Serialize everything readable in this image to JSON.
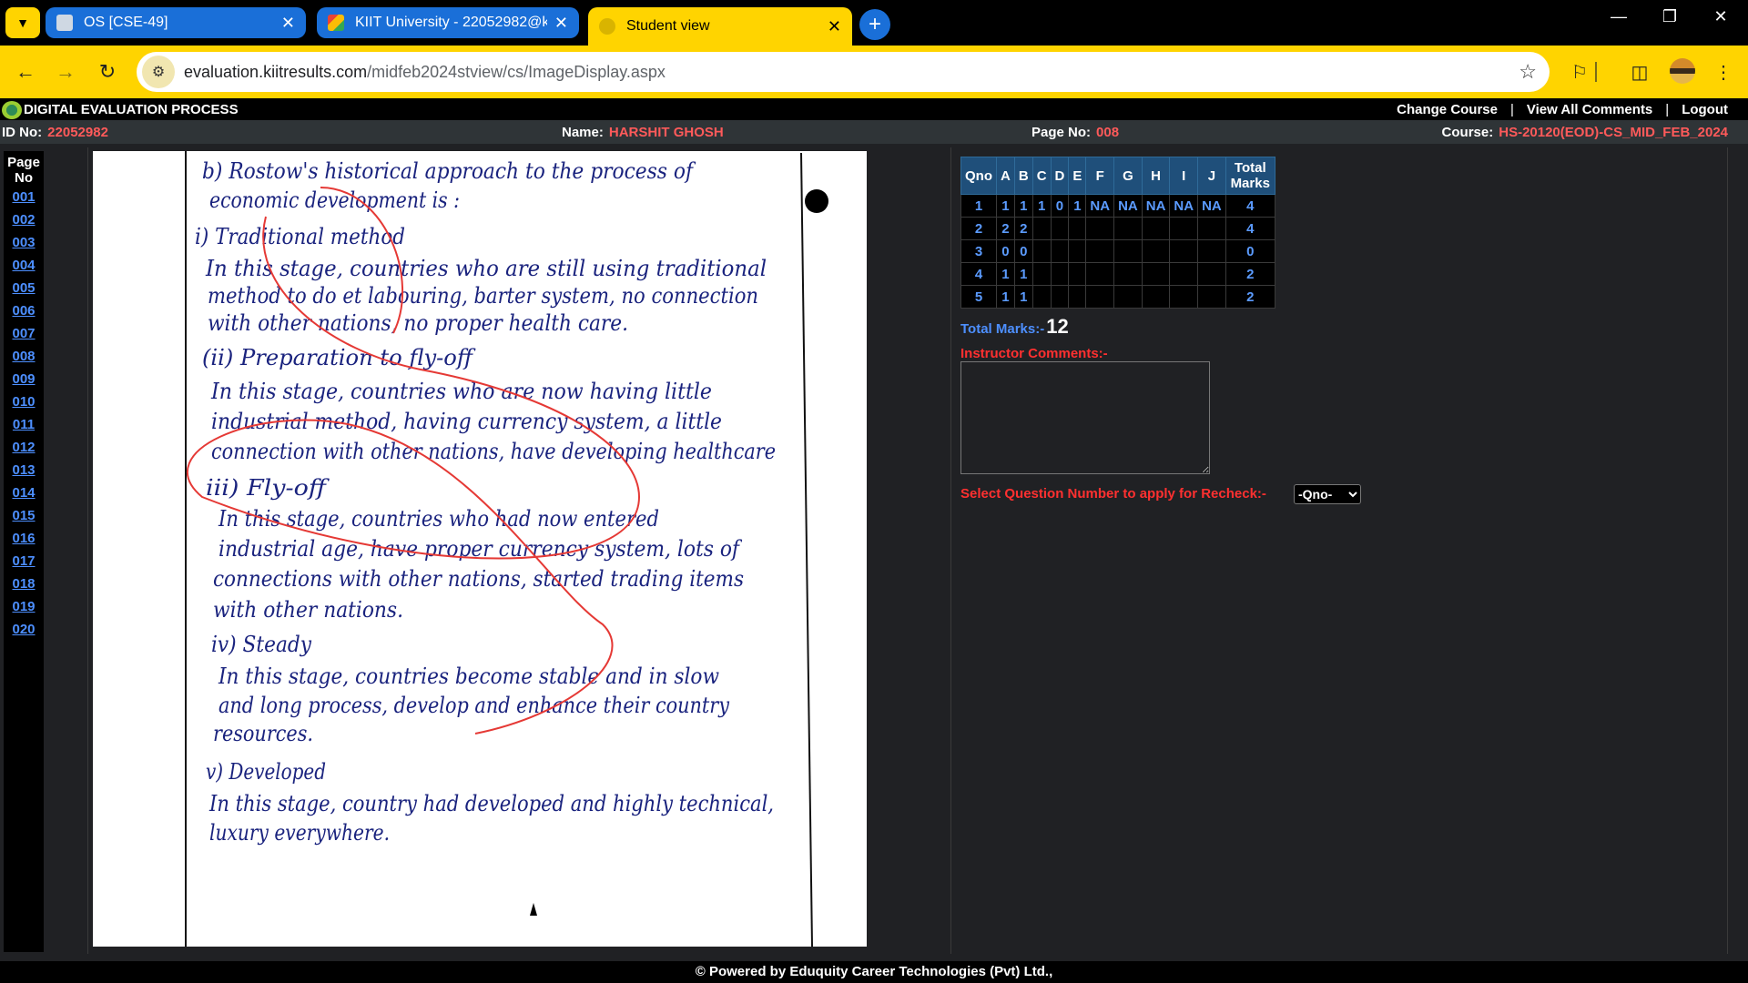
{
  "browser": {
    "tabs": [
      {
        "title": "OS [CSE-49]"
      },
      {
        "title": "KIIT University - 22052982@kiit.ac.in"
      },
      {
        "title": "Student view"
      }
    ],
    "url_domain": "evaluation.kiitresults.com",
    "url_path": "/midfeb2024stview/cs/ImageDisplay.aspx",
    "accent_color": "#ffd400"
  },
  "header": {
    "title": "DIGITAL EVALUATION PROCESS",
    "links": [
      "Change Course",
      "View All Comments",
      "Logout"
    ],
    "separator": "|"
  },
  "info": {
    "id_label": "ID No:",
    "id_value": "22052982",
    "name_label": "Name:",
    "name_value": "HARSHIT GHOSH",
    "page_label": "Page No:",
    "page_value": "008",
    "course_label": "Course:",
    "course_value": "HS-20120(EOD)-CS_MID_FEB_2024"
  },
  "pagelist": {
    "header_line1": "Page",
    "header_line2": "No",
    "pages": [
      "001",
      "002",
      "003",
      "004",
      "005",
      "006",
      "007",
      "008",
      "009",
      "010",
      "011",
      "012",
      "013",
      "014",
      "015",
      "016",
      "017",
      "018",
      "019",
      "020"
    ]
  },
  "answer_sheet": {
    "lines": [
      "b) Rostow's historical approach to the process of",
      "economic development is :",
      "i) Traditional method",
      "In this stage, countries who are still using traditional",
      "method to do et labouring, barter system, no connection",
      "with other nations, no proper health care.",
      "(ii) Preparation to fly-off",
      "In this stage, countries who are now having little",
      "industrial method, having currency system, a little",
      "connection with other nations, have developing healthcare",
      "iii) Fly-off",
      "In this stage, countries who had now entered",
      "industrial age, have proper currency system, lots of",
      "connections with other nations, started trading items",
      "with other nations.",
      "iv) Steady",
      "In this stage, countries become stable and in slow",
      "and long process, develop and enhance their country",
      "resources.",
      "v) Developed",
      "In this stage, country had developed and highly technical,",
      "luxury everywhere."
    ]
  },
  "marks": {
    "headers": [
      "Qno",
      "A",
      "B",
      "C",
      "D",
      "E",
      "F",
      "G",
      "H",
      "I",
      "J",
      "Total Marks"
    ],
    "rows": [
      [
        "1",
        "1",
        "1",
        "1",
        "0",
        "1",
        "NA",
        "NA",
        "NA",
        "NA",
        "NA",
        "4"
      ],
      [
        "2",
        "2",
        "2",
        "",
        "",
        "",
        "",
        "",
        "",
        "",
        "",
        "4"
      ],
      [
        "3",
        "0",
        "0",
        "",
        "",
        "",
        "",
        "",
        "",
        "",
        "",
        "0"
      ],
      [
        "4",
        "1",
        "1",
        "",
        "",
        "",
        "",
        "",
        "",
        "",
        "",
        "2"
      ],
      [
        "5",
        "1",
        "1",
        "",
        "",
        "",
        "",
        "",
        "",
        "",
        "",
        "2"
      ]
    ],
    "total_label": "Total Marks:-",
    "total_value": "12",
    "comments_label": "Instructor Comments:-",
    "comments_value": "",
    "recheck_label": "Select Question Number to apply for Recheck:-",
    "recheck_selected": "-Qno-"
  },
  "footer": {
    "text": "© Powered by Eduquity Career Technologies (Pvt) Ltd.,"
  }
}
